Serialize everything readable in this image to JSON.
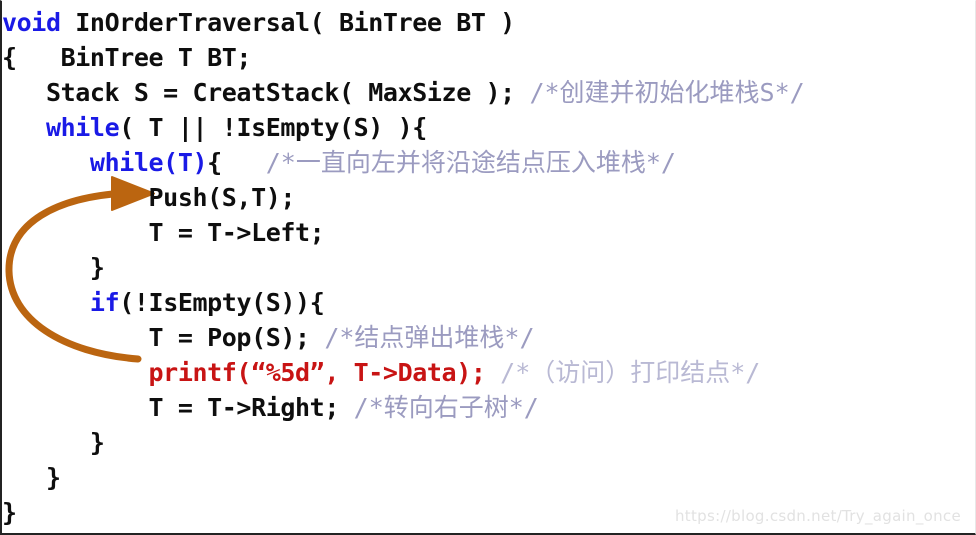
{
  "document": {
    "title": "InOrderTraversal pseudocode slide",
    "background_color": "#ffffff",
    "border_color": "#232323"
  },
  "colors": {
    "keyword": "#1a1ae6",
    "code": "#0e0e0e",
    "comment": "#9b9bc0",
    "highlight_red": "#c81414",
    "arrow": "#bb6510",
    "watermark": "#e2e2e2"
  },
  "code": {
    "lines": [
      {
        "indent": 0,
        "segments": [
          {
            "style": "kw",
            "text": "void"
          },
          {
            "style": "plain",
            "text": " InOrderTraversal( BinTree BT )"
          }
        ]
      },
      {
        "indent": 0,
        "segments": [
          {
            "style": "plain",
            "text": "{   BinTree T BT;"
          }
        ]
      },
      {
        "indent": 0,
        "segments": [
          {
            "style": "plain",
            "text": "   Stack S = CreatStack( MaxSize ); "
          },
          {
            "style": "cmt",
            "text": "/*创建并初始化堆栈S*/"
          }
        ]
      },
      {
        "indent": 0,
        "segments": [
          {
            "style": "plain",
            "text": "   "
          },
          {
            "style": "kw",
            "text": "while"
          },
          {
            "style": "plain",
            "text": "( T || !IsEmpty(S) ){"
          }
        ]
      },
      {
        "indent": 0,
        "segments": [
          {
            "style": "plain",
            "text": "      "
          },
          {
            "style": "kw",
            "text": "while(T)"
          },
          {
            "style": "plain",
            "text": "{   "
          },
          {
            "style": "cmt",
            "text": "/*一直向左并将沿途结点压入堆栈*/"
          }
        ]
      },
      {
        "indent": 0,
        "segments": [
          {
            "style": "plain",
            "text": "          Push(S,T);"
          }
        ]
      },
      {
        "indent": 0,
        "segments": [
          {
            "style": "plain",
            "text": "          T = T->Left;"
          }
        ]
      },
      {
        "indent": 0,
        "segments": [
          {
            "style": "plain",
            "text": "      }"
          }
        ]
      },
      {
        "indent": 0,
        "segments": [
          {
            "style": "plain",
            "text": "      "
          },
          {
            "style": "kw",
            "text": "if"
          },
          {
            "style": "plain",
            "text": "(!IsEmpty(S)){"
          }
        ]
      },
      {
        "indent": 0,
        "segments": [
          {
            "style": "plain",
            "text": "          T = Pop(S); "
          },
          {
            "style": "cmt",
            "text": "/*结点弹出堆栈*/"
          }
        ]
      },
      {
        "indent": 0,
        "segments": [
          {
            "style": "plain",
            "text": "          "
          },
          {
            "style": "red",
            "text": "printf(“%5d”, T->Data); "
          },
          {
            "style": "redcmt",
            "text": "/*（访问）打印结点*/"
          }
        ]
      },
      {
        "indent": 0,
        "segments": [
          {
            "style": "plain",
            "text": "          T = T->Right; "
          },
          {
            "style": "cmt",
            "text": "/*转向右子树*/"
          }
        ]
      },
      {
        "indent": 0,
        "segments": [
          {
            "style": "plain",
            "text": "      }"
          }
        ]
      },
      {
        "indent": 0,
        "segments": [
          {
            "style": "plain",
            "text": "   }"
          }
        ]
      },
      {
        "indent": 0,
        "segments": [
          {
            "style": "plain",
            "text": "}"
          }
        ]
      }
    ]
  },
  "annotation": {
    "arrow_name": "loop-back-arrow",
    "arrow_color": "#bb6510",
    "arrow_description": "C-shaped curved arrow pointing right at the Push(S,T) line"
  },
  "watermark": {
    "text": "https://blog.csdn.net/Try_again_once"
  }
}
